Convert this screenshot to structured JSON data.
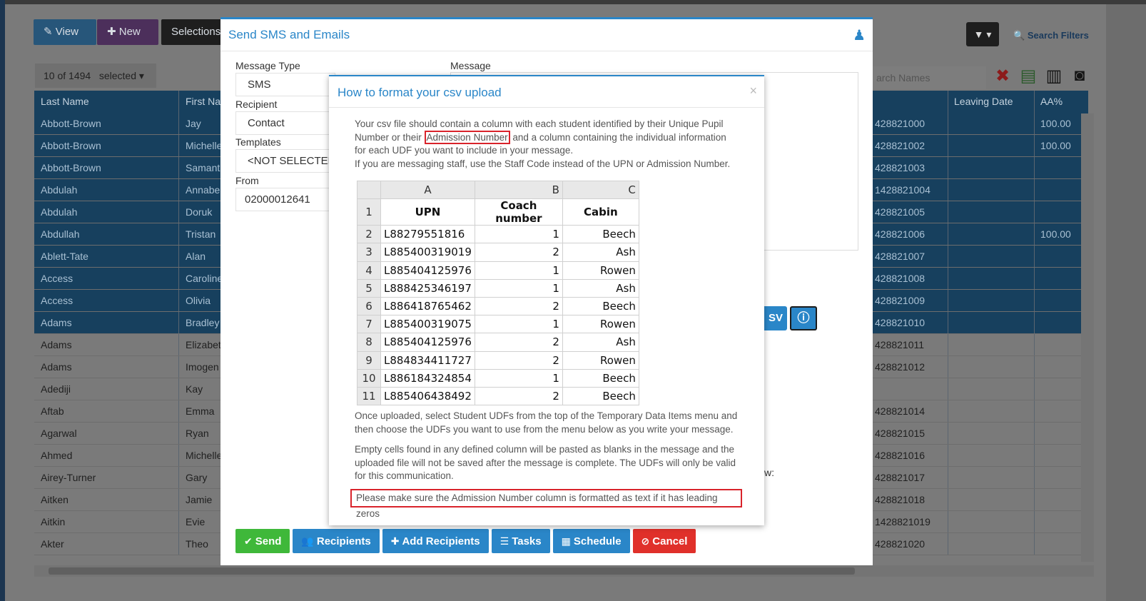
{
  "background": {
    "buttons": {
      "view": "View",
      "new": "New",
      "selections": "Selections"
    },
    "count": "10 of 1494",
    "selected": "selected",
    "search_filters": "Search Filters",
    "search_names_placeholder": "arch Names",
    "columns": {
      "last_name": "Last Name",
      "first_name": "First Na",
      "leaving_date": "Leaving Date",
      "aa": "AA%"
    },
    "rows": [
      {
        "last": "Abbott-Brown",
        "first": "Jay",
        "upn": "428821000",
        "aa": "100.00",
        "sel": true
      },
      {
        "last": "Abbott-Brown",
        "first": "Michelle",
        "upn": "428821002",
        "aa": "100.00",
        "sel": true
      },
      {
        "last": "Abbott-Brown",
        "first": "Samanth",
        "upn": "428821003",
        "aa": "",
        "sel": true
      },
      {
        "last": "Abdulah",
        "first": "Annabel",
        "upn": "1428821004",
        "aa": "",
        "sel": true
      },
      {
        "last": "Abdulah",
        "first": "Doruk",
        "upn": "428821005",
        "aa": "",
        "sel": true
      },
      {
        "last": "Abdullah",
        "first": "Tristan",
        "upn": "428821006",
        "aa": "100.00",
        "sel": true
      },
      {
        "last": "Ablett-Tate",
        "first": "Alan",
        "upn": "428821007",
        "aa": "",
        "sel": true
      },
      {
        "last": "Access",
        "first": "Caroline",
        "upn": "428821008",
        "aa": "",
        "sel": true
      },
      {
        "last": "Access",
        "first": "Olivia",
        "upn": "428821009",
        "aa": "",
        "sel": true
      },
      {
        "last": "Adams",
        "first": "Bradley",
        "upn": "428821010",
        "aa": "",
        "sel": true
      },
      {
        "last": "Adams",
        "first": "Elizabeth",
        "upn": "428821011",
        "aa": "",
        "sel": false
      },
      {
        "last": "Adams",
        "first": "Imogen",
        "upn": "428821012",
        "aa": "",
        "sel": false
      },
      {
        "last": "Adediji",
        "first": "Kay",
        "upn": "",
        "aa": "",
        "sel": false
      },
      {
        "last": "Aftab",
        "first": "Emma",
        "upn": "428821014",
        "aa": "",
        "sel": false
      },
      {
        "last": "Agarwal",
        "first": "Ryan",
        "upn": "428821015",
        "aa": "",
        "sel": false
      },
      {
        "last": "Ahmed",
        "first": "Michelle",
        "upn": "428821016",
        "aa": "",
        "sel": false
      },
      {
        "last": "Airey-Turner",
        "first": "Gary",
        "upn": "428821017",
        "aa": "",
        "sel": false
      },
      {
        "last": "Aitken",
        "first": "Jamie",
        "upn": "428821018",
        "aa": "",
        "sel": false
      },
      {
        "last": "Aitkin",
        "first": "Evie",
        "upn": "1428821019",
        "aa": "",
        "sel": false
      },
      {
        "last": "Akter",
        "first": "Theo",
        "upn": "428821020",
        "aa": "",
        "sel": false
      }
    ]
  },
  "modal": {
    "title": "Send SMS and Emails",
    "message_type_label": "Message Type",
    "message_type_value": "SMS",
    "recipient_label": "Recipient",
    "recipient_value": "Contact",
    "templates_label": "Templates",
    "templates_value": "<NOT SELECTED>",
    "from_label": "From",
    "from_value": "02000012641",
    "message_label": "Message",
    "csv_label": "SV",
    "w_label": "w:",
    "buttons": {
      "send": "Send",
      "recipients": "Recipients",
      "add_recipients": "Add Recipients",
      "tasks": "Tasks",
      "schedule": "Schedule",
      "cancel": "Cancel"
    }
  },
  "popup": {
    "title": "How to format your csv upload",
    "close": "×",
    "para1_a": "Your csv file should contain a column with each student identified by their Unique Pupil Number or their ",
    "para1_hl": "Admission Number",
    "para1_b": " and a column containing the individual information for each UDF you want to include in your message.",
    "para1_c": "If you are messaging staff, use the Staff Code instead of the UPN or Admission Number.",
    "sheet": {
      "col_letters": [
        "A",
        "B",
        "C"
      ],
      "headers": [
        "UPN",
        "Coach number",
        "Cabin"
      ],
      "rows": [
        [
          "L88279551816",
          "1",
          "Beech"
        ],
        [
          "L885400319019",
          "2",
          "Ash"
        ],
        [
          "L885404125976",
          "1",
          "Rowen"
        ],
        [
          "L888425346197",
          "1",
          "Ash"
        ],
        [
          "L886418765462",
          "2",
          "Beech"
        ],
        [
          "L885400319075",
          "1",
          "Rowen"
        ],
        [
          "L885404125976",
          "2",
          "Ash"
        ],
        [
          "L884834411727",
          "2",
          "Rowen"
        ],
        [
          "L886184324854",
          "1",
          "Beech"
        ],
        [
          "L885406438492",
          "2",
          "Beech"
        ]
      ]
    },
    "para2": "Once uploaded, select Student UDFs from the top of the Temporary Data Items menu and then choose the UDFs you want to use from the menu below as you write your message.",
    "para3": "Empty cells found in any defined column will be pasted as blanks in the message and the uploaded file will not be saved after the message is complete. The UDFs will only be valid for this communication.",
    "note": "Please make sure the Admission Number column is formatted as text if it has leading zeros"
  }
}
